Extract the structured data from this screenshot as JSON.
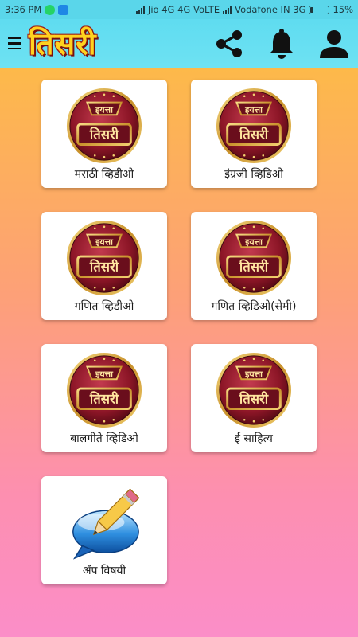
{
  "status": {
    "time": "3:36 PM",
    "carrier1": "Jio 4G  4G  VoLTE",
    "carrier2": "Vodafone IN 3G",
    "battery": "15%",
    "battery_level": 0.15
  },
  "header": {
    "title": "तिसरी",
    "menu_icon": "hamburger-icon",
    "share_icon": "share-icon",
    "bell_icon": "bell-icon",
    "profile_icon": "person-icon"
  },
  "logo": {
    "line1": "इयत्ता",
    "line2": "तिसरी"
  },
  "cards": [
    {
      "label": "मराठी व्हिडीओ",
      "icon": "iyatta-tisri-badge"
    },
    {
      "label": "इंग्रजी व्हिडिओ",
      "icon": "iyatta-tisri-badge"
    },
    {
      "label": "गणित व्हिडीओ",
      "icon": "iyatta-tisri-badge"
    },
    {
      "label": "गणित व्हिडिओ(सेमी)",
      "icon": "iyatta-tisri-badge"
    },
    {
      "label": "बालगीते व्हिडिओ",
      "icon": "iyatta-tisri-badge"
    },
    {
      "label": "ई साहित्य",
      "icon": "iyatta-tisri-badge"
    },
    {
      "label": "ॲप विषयी",
      "icon": "pencil-speech-bubble"
    }
  ],
  "colors": {
    "appbar": "#5fdcf0",
    "title_fill": "#ffd21f",
    "badge_red": "#9a1b2b",
    "badge_gold": "#d8a532"
  }
}
